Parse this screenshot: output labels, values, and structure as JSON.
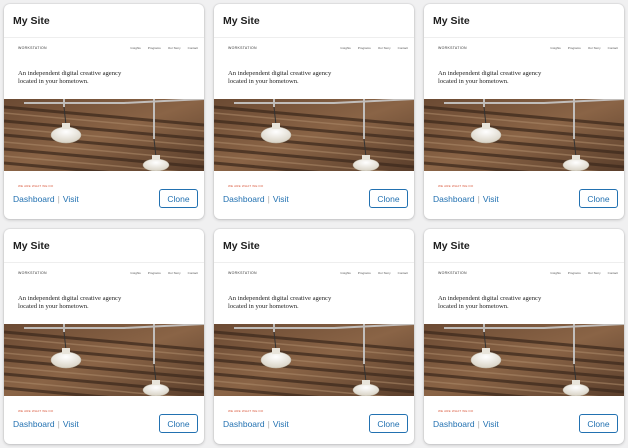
{
  "sites": [
    {
      "title": "My Site",
      "brand": "WORKSTATION",
      "nav": [
        "Insights",
        "Programs",
        "Our Story",
        "Contact"
      ],
      "hero": "An independent digital creative agency located in your hometown.",
      "tagline": "WE ARE WHAT WE DO",
      "dashboard": "Dashboard",
      "visit": "Visit",
      "clone": "Clone"
    },
    {
      "title": "My Site",
      "brand": "WORKSTATION",
      "nav": [
        "Insights",
        "Programs",
        "Our Story",
        "Contact"
      ],
      "hero": "An independent digital creative agency located in your hometown.",
      "tagline": "WE ARE WHAT WE DO",
      "dashboard": "Dashboard",
      "visit": "Visit",
      "clone": "Clone"
    },
    {
      "title": "My Site",
      "brand": "WORKSTATION",
      "nav": [
        "Insights",
        "Programs",
        "Our Story",
        "Contact"
      ],
      "hero": "An independent digital creative agency located in your hometown.",
      "tagline": "WE ARE WHAT WE DO",
      "dashboard": "Dashboard",
      "visit": "Visit",
      "clone": "Clone"
    },
    {
      "title": "My Site",
      "brand": "WORKSTATION",
      "nav": [
        "Insights",
        "Programs",
        "Our Story",
        "Contact"
      ],
      "hero": "An independent digital creative agency located in your hometown.",
      "tagline": "WE ARE WHAT WE DO",
      "dashboard": "Dashboard",
      "visit": "Visit",
      "clone": "Clone"
    },
    {
      "title": "My Site",
      "brand": "WORKSTATION",
      "nav": [
        "Insights",
        "Programs",
        "Our Story",
        "Contact"
      ],
      "hero": "An independent digital creative agency located in your hometown.",
      "tagline": "WE ARE WHAT WE DO",
      "dashboard": "Dashboard",
      "visit": "Visit",
      "clone": "Clone"
    },
    {
      "title": "My Site",
      "brand": "WORKSTATION",
      "nav": [
        "Insights",
        "Programs",
        "Our Story",
        "Contact"
      ],
      "hero": "An independent digital creative agency located in your hometown.",
      "tagline": "WE ARE WHAT WE DO",
      "dashboard": "Dashboard",
      "visit": "Visit",
      "clone": "Clone"
    }
  ],
  "colors": {
    "link": "#2271b1",
    "tagline": "#d9573b",
    "background": "#f0f0f1"
  }
}
